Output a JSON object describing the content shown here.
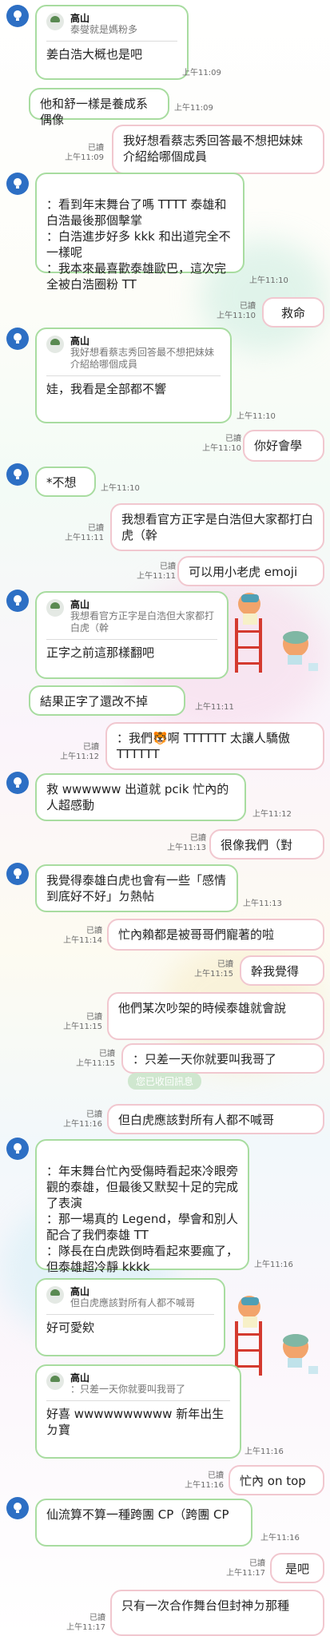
{
  "messages": {
    "m1_quote_name": "高山",
    "m1_quote_text": "泰燮就是媽粉多",
    "m1_text": "姜白浩大概也是吧",
    "m1_time": "上午11:09",
    "m2_text": "他和舒一樣是養成系偶像",
    "m2_time": "上午11:09",
    "m3_text": "我好想看蔡志秀回答最不想把妹妹介紹給哪個成員",
    "m3_read": "已讀",
    "m3_time": "上午11:09",
    "m4_text": "：看到年末舞台了嗎 TTTT 泰雄和白浩最後那個擊掌\n：白浩進步好多 kkk 和出道完全不一樣呢\n：我本來最喜歡泰雄歐巴，這次完全被白浩圈粉 TT",
    "m4_time": "上午11:10",
    "m5_text": "救命",
    "m5_read": "已讀",
    "m5_time": "上午11:10",
    "m6_quote_name": "高山",
    "m6_quote_text": "我好想看蔡志秀回答最不想把妹妹介紹給哪個成員",
    "m6_text": "娃，我看是全部都不響",
    "m6_time": "上午11:10",
    "m7_text": "你好會學",
    "m7_read": "已讀",
    "m7_time": "上午11:10",
    "m8_text": "*不想",
    "m8_time": "上午11:10",
    "m9_text": "我想看官方正字是白浩但大家都打白虎（幹",
    "m9_read": "已讀",
    "m9_time": "上午11:11",
    "m10_text": "可以用小老虎 emoji",
    "m10_read": "已讀",
    "m10_time": "上午11:11",
    "m11_quote_name": "高山",
    "m11_quote_text": "我想看官方正字是白浩但大家都打白虎（幹",
    "m11_text": "正字之前這那樣翻吧",
    "m11_time": "上午11:11",
    "m12_text": "結果正字了還改不掉",
    "m12_time": "上午11:11",
    "m13_text": "：我們🐯啊 TTTTTT 太讓人驕傲 TTTTTT",
    "m13_read": "已讀",
    "m13_time": "上午11:12",
    "m14_text": "救 wwwwww 出道就 pcik 忙內的人超感動",
    "m14_time": "上午11:12",
    "m15_text": "很像我們（對",
    "m15_read": "已讀",
    "m15_time": "上午11:13",
    "m16_text": "我覺得泰雄白虎也會有一些「感情到底好不好」ㄉ熱帖",
    "m16_time": "上午11:13",
    "m17_text": "忙內賴都是被哥哥們寵著的啦",
    "m17_read": "已讀",
    "m17_time": "上午11:14",
    "m18_text": "幹我覺得",
    "m18_read": "已讀",
    "m18_time": "上午11:15",
    "m19_text": "他們某次吵架的時候泰雄就會說",
    "m19_read": "已讀",
    "m19_time": "上午11:15",
    "m20_text": "：只差一天你就要叫我哥了",
    "m20_read": "已讀",
    "m20_time": "上午11:15",
    "system_text": "您已收回訊息",
    "m21_text": "但白虎應該對所有人都不喊哥",
    "m21_read": "已讀",
    "m21_time": "上午11:16",
    "m22_text": "：年末舞台忙內受傷時看起來冷眼旁觀的泰雄，但最後又默契十足的完成了表演\n：那一場真的 Legend，學會和別人配合了我們泰雄 TT\n：隊長在白虎跌倒時看起來要瘋了，但泰雄超冷靜 kkkk",
    "m22_time": "上午11:16",
    "m23_quote_name": "高山",
    "m23_quote_text": "但白虎應該對所有人都不喊哥",
    "m23_text": "好可愛欸",
    "m23_time": "上午11:16",
    "m24_quote_name": "高山",
    "m24_quote_text": "：只差一天你就要叫我哥了",
    "m24_text": "好喜 wwwwwwwwww 新年出生ㄉ寶",
    "m24_time": "上午11:16",
    "m25_text": "忙內 on top",
    "m25_read": "已讀",
    "m25_time": "上午11:16",
    "m26_text": "仙流算不算一種跨團 CP（跨團 CP",
    "m26_time": "上午11:16",
    "m27_text": "是吧",
    "m27_read": "已讀",
    "m27_time": "上午11:17",
    "m28_text": "只有一次合作舞台但封神ㄉ那種",
    "m28_read": "已讀",
    "m28_time": "上午11:17"
  },
  "colors": {
    "incoming_border": "#a8dca0",
    "outgoing_border": "#f1c7cf",
    "avatar": "#2d6fc4"
  },
  "icons": {
    "avatar": "lightbulb-icon",
    "sticker": "child-on-ladder-sticker"
  }
}
